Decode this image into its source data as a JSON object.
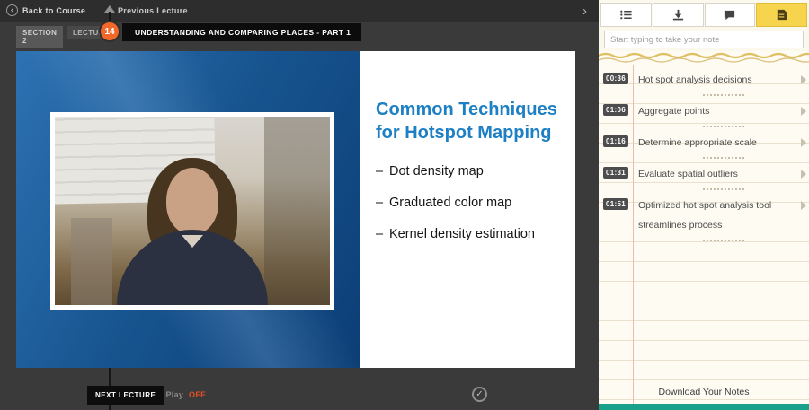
{
  "header": {
    "back_label": "Back to Course",
    "previous_label": "Previous Lecture",
    "section_badge": "SECTION 2",
    "lecture_badge": "LECTURE",
    "lecture_number": "14",
    "lecture_title": "UNDERSTANDING AND COMPARING PLACES - PART 1"
  },
  "slide": {
    "title": "Common Techniques for Hotspot Mapping",
    "bullets": [
      "Dot density map",
      "Graduated color map",
      "Kernel density estimation"
    ]
  },
  "footer": {
    "next_lecture_label": "NEXT LECTURE",
    "autoplay_label": "Auto Play",
    "autoplay_state": "OFF"
  },
  "notes_panel": {
    "tabs": [
      {
        "icon": "list-icon",
        "active": false
      },
      {
        "icon": "download-icon",
        "active": false
      },
      {
        "icon": "comment-icon",
        "active": false
      },
      {
        "icon": "note-icon",
        "active": true
      }
    ],
    "input_placeholder": "Start typing to take your note",
    "entries": [
      {
        "time": "00:36",
        "text": "Hot spot analysis decisions"
      },
      {
        "time": "01:06",
        "text": "Aggregate points"
      },
      {
        "time": "01:16",
        "text": "Determine appropriate scale"
      },
      {
        "time": "01:31",
        "text": "Evaluate spatial outliers"
      },
      {
        "time": "01:51",
        "text": "Optimized hot spot analysis tool streamlines process"
      }
    ],
    "download_label": "Download Your Notes"
  },
  "colors": {
    "accent_orange": "#f2682a",
    "tab_active_yellow": "#f6d44d",
    "slide_title_blue": "#1d80c4",
    "autoplay_off_red": "#e2502a",
    "teal_bar": "#17a18b"
  }
}
